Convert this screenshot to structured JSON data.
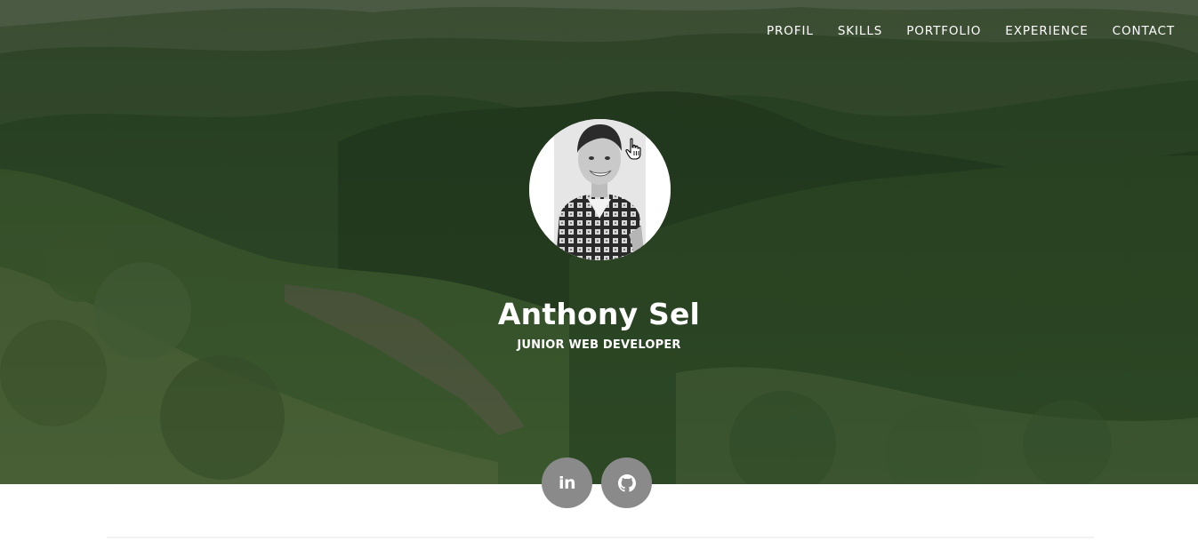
{
  "nav": {
    "items": [
      {
        "label": "PROFIL"
      },
      {
        "label": "SKILLS"
      },
      {
        "label": "PORTFOLIO"
      },
      {
        "label": "EXPERIENCE"
      },
      {
        "label": "CONTACT"
      }
    ]
  },
  "profile": {
    "name": "Anthony Sel",
    "role": "JUNIOR WEB DEVELOPER"
  },
  "social": {
    "linkedin_label": "in",
    "linkedin_icon": "linkedin-icon",
    "github_icon": "github-icon"
  },
  "colors": {
    "hero_overlay": "#2b3c25",
    "social_button": "#8a8a8a",
    "text": "#ffffff"
  }
}
